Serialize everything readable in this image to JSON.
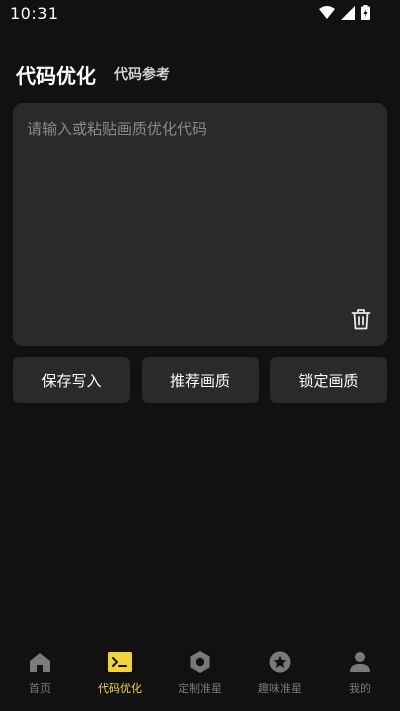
{
  "status_bar": {
    "time": "10:31"
  },
  "header": {
    "title": "代码优化",
    "subtitle": "代码参考"
  },
  "editor": {
    "placeholder": "请输入或粘贴画质优化代码",
    "value": ""
  },
  "actions": [
    {
      "label": "保存写入"
    },
    {
      "label": "推荐画质"
    },
    {
      "label": "锁定画质"
    }
  ],
  "bottom_nav": {
    "active_index": 1,
    "items": [
      {
        "label": "首页",
        "icon": "home-icon"
      },
      {
        "label": "代码优化",
        "icon": "terminal-icon"
      },
      {
        "label": "定制准星",
        "icon": "hexagon-icon"
      },
      {
        "label": "趣味准星",
        "icon": "star-circle-icon"
      },
      {
        "label": "我的",
        "icon": "user-icon"
      }
    ]
  },
  "colors": {
    "background": "#111111",
    "card": "#2a2a2a",
    "accent": "#f2d535",
    "inactive": "#7a7a7a"
  }
}
